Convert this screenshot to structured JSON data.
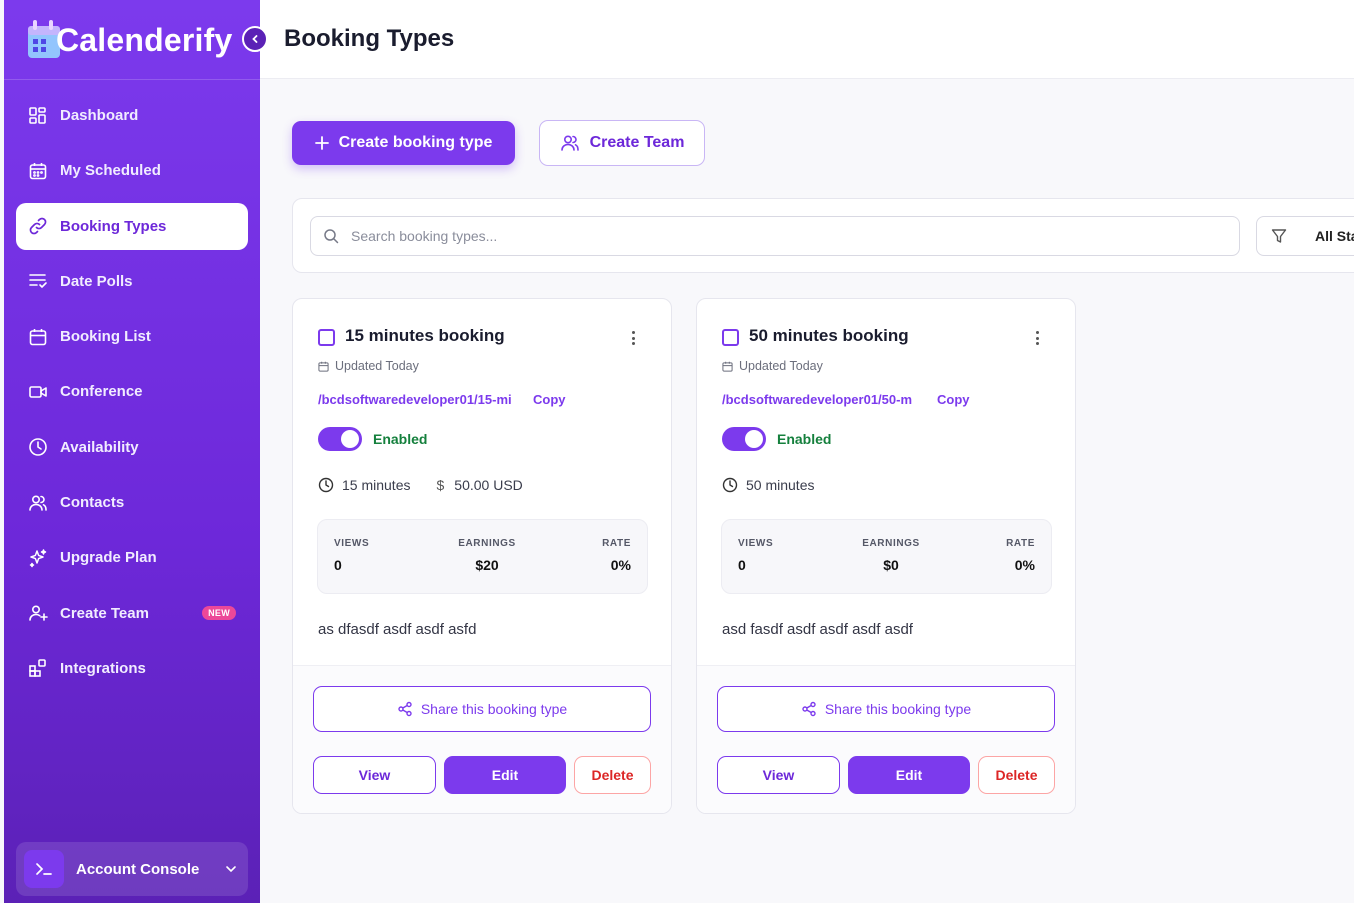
{
  "app": {
    "logo_text": "Calenderify"
  },
  "sidebar": {
    "items": [
      {
        "label": "Dashboard",
        "icon": "dashboard-grid-icon"
      },
      {
        "label": "My Scheduled",
        "icon": "calendar-icon"
      },
      {
        "label": "Booking Types",
        "icon": "link-icon",
        "active": true
      },
      {
        "label": "Date Polls",
        "icon": "list-check-icon"
      },
      {
        "label": "Booking List",
        "icon": "calendar-list-icon"
      },
      {
        "label": "Conference",
        "icon": "video-icon"
      },
      {
        "label": "Availability",
        "icon": "clock-icon"
      },
      {
        "label": "Contacts",
        "icon": "users-icon"
      },
      {
        "label": "Upgrade Plan",
        "icon": "sparkle-icon"
      },
      {
        "label": "Create Team",
        "icon": "user-plus-icon",
        "badge": "NEW"
      },
      {
        "label": "Integrations",
        "icon": "blocks-icon"
      }
    ],
    "account": {
      "label": "Account Console",
      "icon": "terminal-icon"
    }
  },
  "header": {
    "title": "Booking Types"
  },
  "actions": {
    "create_booking_label": "Create booking type",
    "create_team_label": "Create Team"
  },
  "filters": {
    "search_placeholder": "Search booking types...",
    "status_label": "All Sta"
  },
  "cards": [
    {
      "title": "15 minutes booking",
      "updated": "Updated Today",
      "link": "/bcdsoftwaredeveloper01/15-mi",
      "copy_label": "Copy",
      "status": "Enabled",
      "duration": "15 minutes",
      "price": "50.00 USD",
      "stats": {
        "views_label": "VIEWS",
        "views": "0",
        "earnings_label": "EARNINGS",
        "earnings": "$20",
        "rate_label": "RATE",
        "rate": "0%"
      },
      "description": "as dfasdf asdf asdf asfd",
      "share_label": "Share this booking type",
      "view_label": "View",
      "edit_label": "Edit",
      "delete_label": "Delete"
    },
    {
      "title": "50 minutes booking",
      "updated": "Updated Today",
      "link": "/bcdsoftwaredeveloper01/50-m",
      "copy_label": "Copy",
      "status": "Enabled",
      "duration": "50 minutes",
      "price": "",
      "stats": {
        "views_label": "VIEWS",
        "views": "0",
        "earnings_label": "EARNINGS",
        "earnings": "$0",
        "rate_label": "RATE",
        "rate": "0%"
      },
      "description": "asd fasdf asdf asdf asdf asdf",
      "share_label": "Share this booking type",
      "view_label": "View",
      "edit_label": "Edit",
      "delete_label": "Delete"
    }
  ],
  "colors": {
    "brand": "#7c3aed",
    "brand_dark": "#5b21b6",
    "enabled_green": "#15803d",
    "delete_red": "#dc2626",
    "badge_pink": "#ec4899"
  }
}
